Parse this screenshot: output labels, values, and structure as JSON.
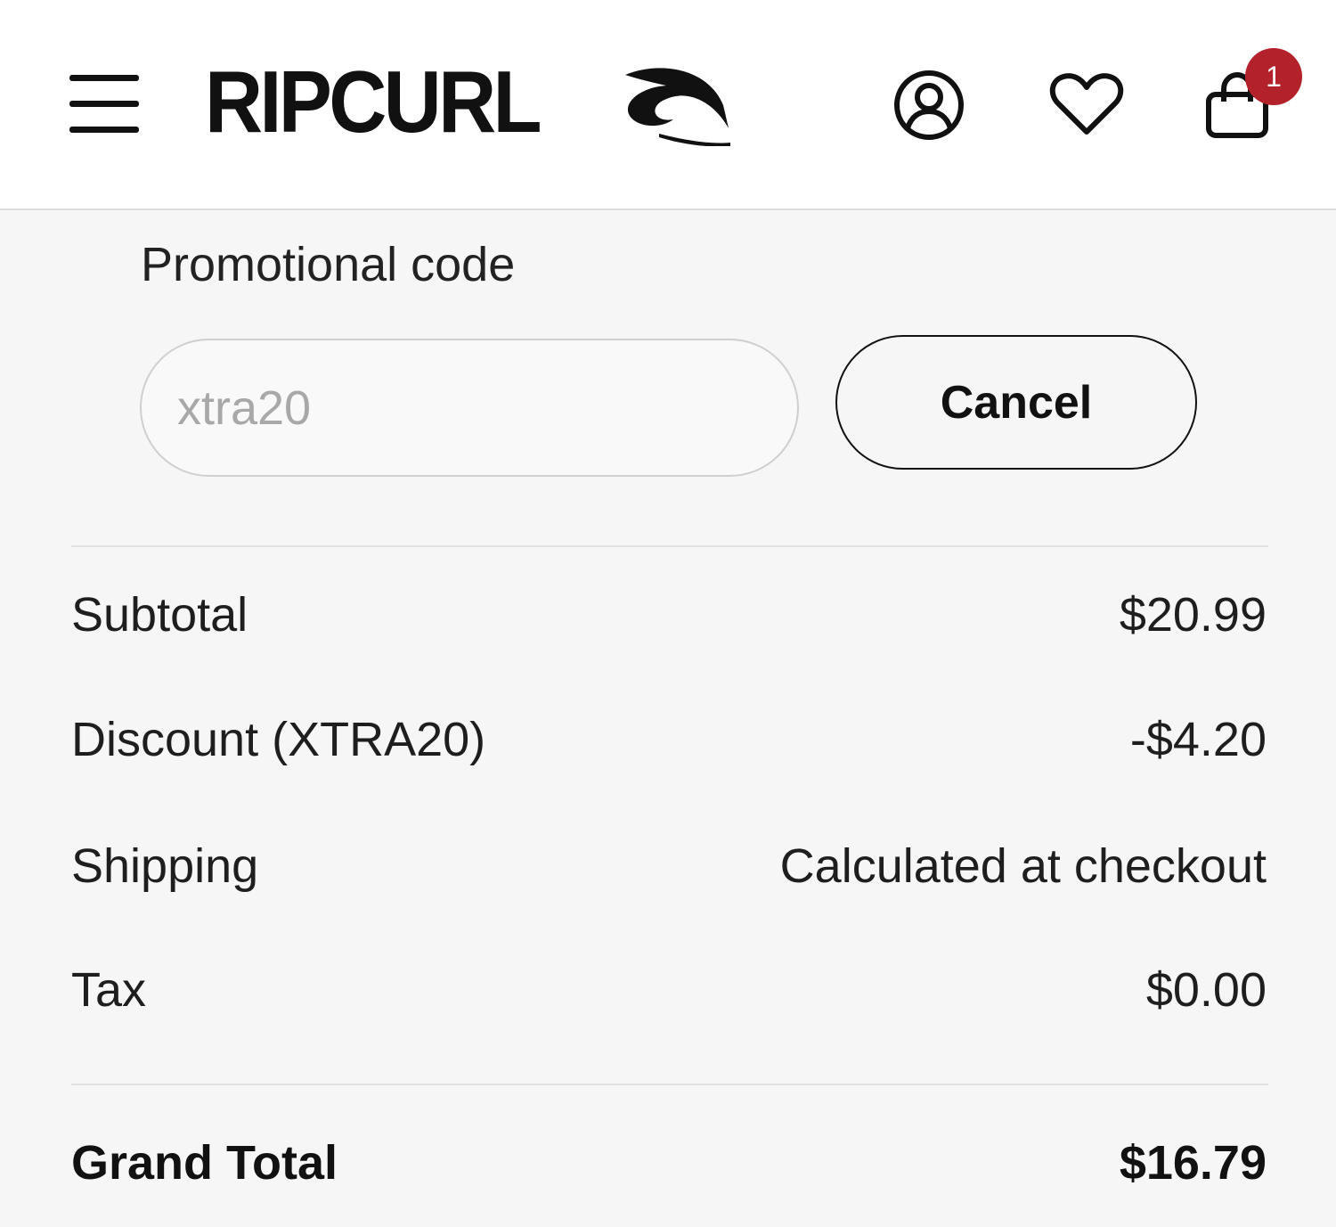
{
  "header": {
    "brand": "RIPCURL",
    "cart_count": "1",
    "icons": [
      "menu-icon",
      "account-icon",
      "heart-icon",
      "bag-icon"
    ]
  },
  "promo": {
    "label": "Promotional code",
    "value": "xtra20",
    "cancel_label": "Cancel"
  },
  "summary": [
    {
      "label": "Subtotal",
      "value": "$20.99"
    },
    {
      "label": "Discount (XTRA20)",
      "value": "-$4.20"
    },
    {
      "label": "Shipping",
      "value": "Calculated at checkout"
    },
    {
      "label": "Tax",
      "value": "$0.00"
    }
  ],
  "grand_total": {
    "label": "Grand Total",
    "value": "$16.79"
  },
  "colors": {
    "badge": "#b3222b",
    "background": "#f6f6f6",
    "header": "#ffffff"
  }
}
